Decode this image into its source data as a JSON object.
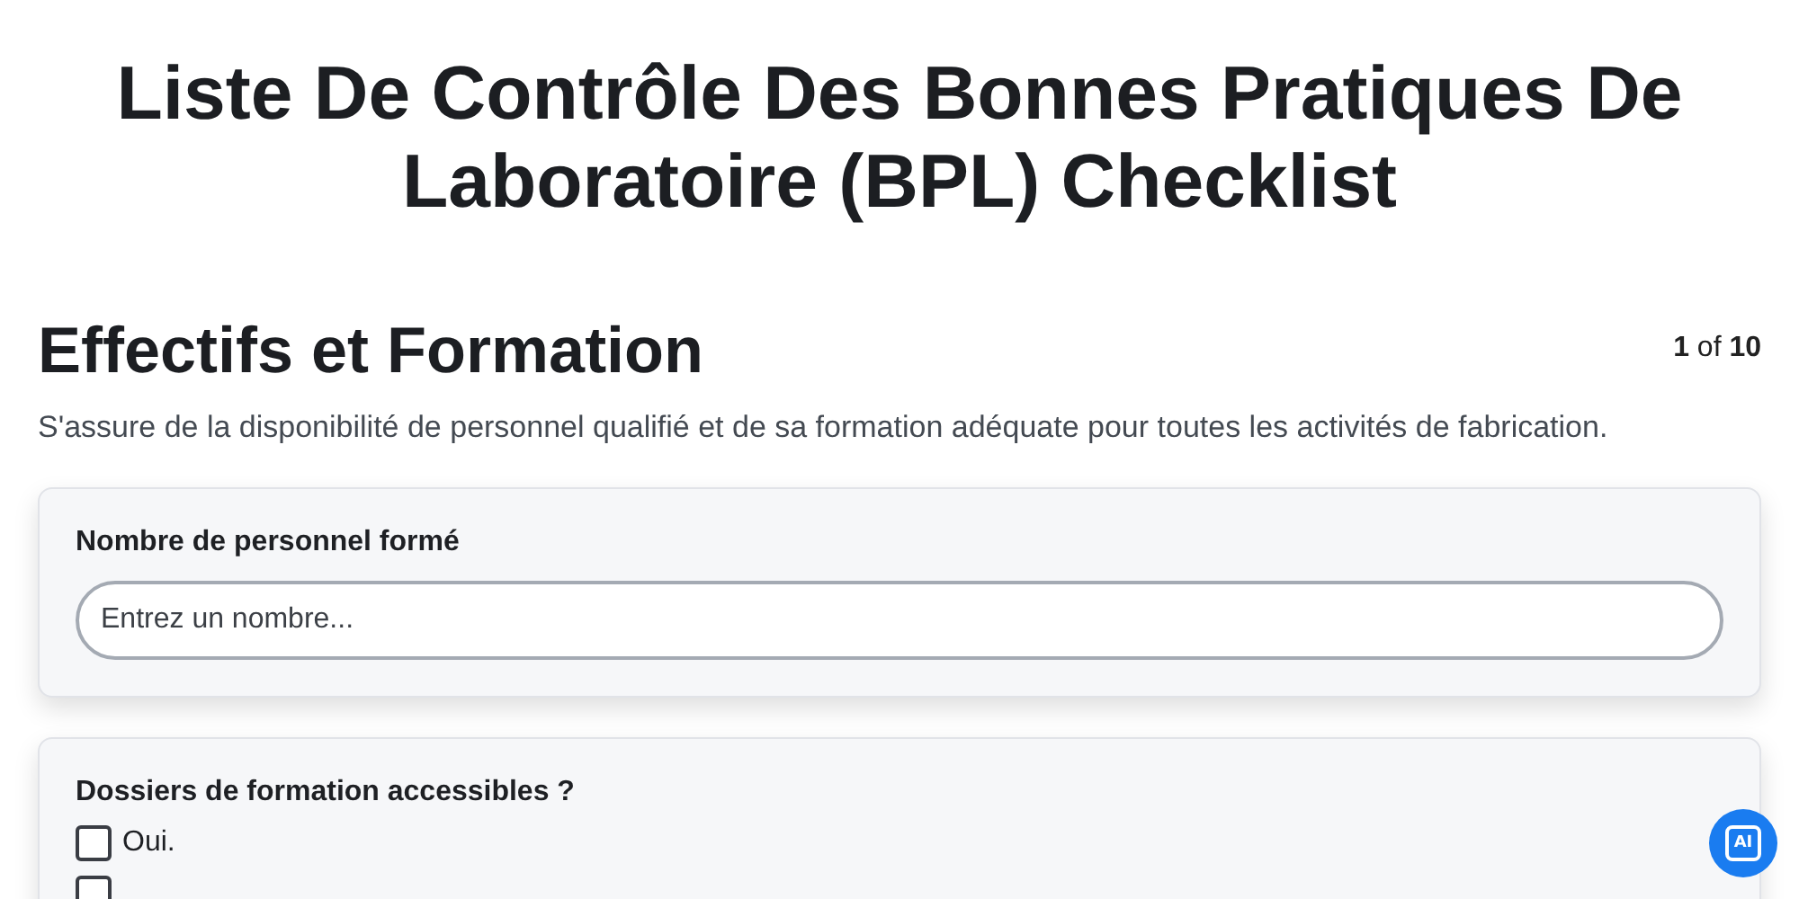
{
  "title": "Liste De Contrôle Des Bonnes Pratiques De Laboratoire (BPL) Checklist",
  "section": {
    "heading": "Effectifs et Formation",
    "counter": "**1** of **10**",
    "description": "S'assure de la disponibilité de personnel qualifié et de sa formation adéquate pour toutes les activités de fabrication."
  },
  "questions": [
    {
      "kind": "number",
      "label": "Nombre de personnel formé",
      "placeholder": "Entrez un nombre..."
    },
    {
      "kind": "checkboxes",
      "label": "Dossiers de formation accessibles ?",
      "options": [
        {
          "label": "Oui.",
          "checked": false
        },
        {
          "checked": false
        }
      ]
    }
  ],
  "assistant_button": {
    "label": "AI"
  }
}
